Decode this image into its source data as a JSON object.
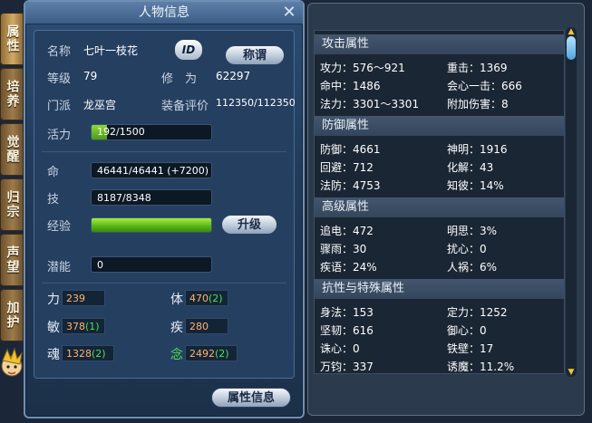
{
  "side_tabs": [
    "属性",
    "培养",
    "觉醒",
    "归宗",
    "声望",
    "加护"
  ],
  "window": {
    "title": "人物信息"
  },
  "profile": {
    "name_label": "名称",
    "name": "七叶一枝花",
    "id_badge": "ID",
    "title_btn": "称谓",
    "level_label": "等级",
    "level": "79",
    "cultivation_label": "修　为",
    "cultivation": "62297",
    "sect_label": "门派",
    "sect": "龙巫宫",
    "gear_label": "装备评价",
    "gear": "112350/112350",
    "vitality_label": "活力",
    "vitality": "192/1500",
    "vitality_ratio": 0.128
  },
  "vitals": {
    "hp_label": "命",
    "hp": "46441/46441 (+7200)",
    "skill_label": "技",
    "skill": "8187/8348",
    "exp_label": "经验",
    "exp_ratio": 1.0,
    "upgrade_btn": "升级",
    "potential_label": "潜能",
    "potential": "0"
  },
  "attributes": [
    {
      "label": "力",
      "value": "239",
      "bonus": ""
    },
    {
      "label": "体",
      "value": "470",
      "bonus": "(2)"
    },
    {
      "label": "敏",
      "value": "378",
      "bonus": "(1)"
    },
    {
      "label": "疾",
      "value": "280",
      "bonus": ""
    },
    {
      "label": "魂",
      "value": "1328",
      "bonus": "(2)"
    },
    {
      "label": "念",
      "value": "2492",
      "bonus": "(2)"
    }
  ],
  "attr_info_btn": "属性信息",
  "stats": {
    "attack": {
      "title": "攻击属性",
      "rows": [
        [
          "攻力：576～921",
          "重击：1369"
        ],
        [
          "命中：1486",
          "会心一击：666"
        ],
        [
          "法力：3301～3301",
          "附加伤害：8"
        ]
      ]
    },
    "defense": {
      "title": "防御属性",
      "rows": [
        [
          "防御：4661",
          "神明：1916"
        ],
        [
          "回避：712",
          "化解：43"
        ],
        [
          "法防：4753",
          "知彼：14%"
        ]
      ]
    },
    "advanced": {
      "title": "高级属性",
      "rows": [
        [
          "追电：472",
          "明思：3%"
        ],
        [
          "骤雨：30",
          "扰心：0"
        ],
        [
          "疾语：24%",
          "人祸：6%"
        ]
      ]
    },
    "resist": {
      "title": "抗性与特殊属性",
      "rows": [
        [
          "身法：153",
          "定力：1252"
        ],
        [
          "坚韧：616",
          "御心：0"
        ],
        [
          "诛心：0",
          "铁壁：17"
        ],
        [
          "万钧：337",
          "诱魔：11.2%"
        ]
      ]
    }
  },
  "colors": {
    "accent_bonus": "#4fe04f",
    "attr_value": "#ffb36a"
  }
}
